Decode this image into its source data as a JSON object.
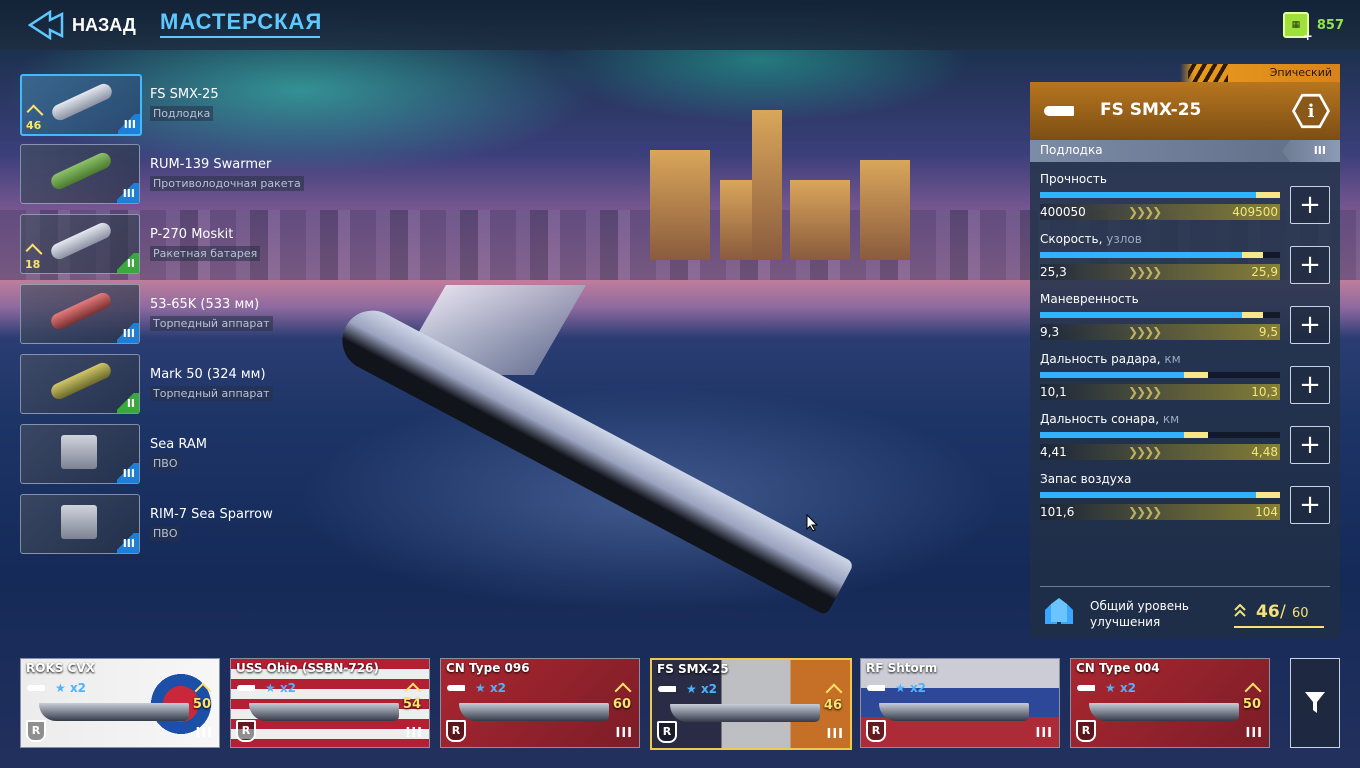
{
  "topbar": {
    "back_label": "НАЗАД",
    "title": "МАСТЕРСКАЯ",
    "title_sub": "",
    "currency": "857",
    "currency_icon": "green-token-icon"
  },
  "modules": [
    {
      "name": "FS SMX-25",
      "type": "Подлодка",
      "level": "46",
      "tier": "III",
      "tier_color": "#1e7fd8",
      "selected": true
    },
    {
      "name": "RUM-139 Swarmer",
      "type": "Противолодочная ракета",
      "level": "",
      "tier": "III",
      "tier_color": "#1e7fd8",
      "selected": false
    },
    {
      "name": "P-270 Moskit",
      "type": "Ракетная батарея",
      "level": "18",
      "tier": "II",
      "tier_color": "#39a83d",
      "selected": false
    },
    {
      "name": "53-65K (533 мм)",
      "type": "Торпедный аппарат",
      "level": "",
      "tier": "III",
      "tier_color": "#1e7fd8",
      "selected": false
    },
    {
      "name": "Mark 50 (324 мм)",
      "type": "Торпедный аппарат",
      "level": "",
      "tier": "II",
      "tier_color": "#39a83d",
      "selected": false
    },
    {
      "name": "Sea RAM",
      "type": "ПВО",
      "level": "",
      "tier": "III",
      "tier_color": "#1e7fd8",
      "selected": false
    },
    {
      "name": "RIM-7 Sea Sparrow",
      "type": "ПВО",
      "level": "",
      "tier": "III",
      "tier_color": "#1e7fd8",
      "selected": false
    }
  ],
  "panel": {
    "rarity": "Эпический",
    "title": "FS SMX-25",
    "class": "Подлодка",
    "tier": "III",
    "stats": [
      {
        "label": "Прочность",
        "unit": "",
        "current": "400050",
        "max": "409500",
        "fill": 0.9,
        "upgrade": 0.1
      },
      {
        "label": "Скорость,",
        "unit": "узлов",
        "current": "25,3",
        "max": "25,9",
        "fill": 0.84,
        "upgrade": 0.09
      },
      {
        "label": "Маневренность",
        "unit": "",
        "current": "9,3",
        "max": "9,5",
        "fill": 0.84,
        "upgrade": 0.09
      },
      {
        "label": "Дальность радара,",
        "unit": "км",
        "current": "10,1",
        "max": "10,3",
        "fill": 0.6,
        "upgrade": 0.1
      },
      {
        "label": "Дальность сонара,",
        "unit": "км",
        "current": "4,41",
        "max": "4,48",
        "fill": 0.6,
        "upgrade": 0.1
      },
      {
        "label": "Запас воздуха",
        "unit": "",
        "current": "101,6",
        "max": "104",
        "fill": 0.9,
        "upgrade": 0.1
      }
    ],
    "upgrade": {
      "label": "Общий уровень улучшения",
      "current": "46",
      "sep": "/",
      "max": "60"
    }
  },
  "fleet": [
    {
      "name": "ROKS CVX",
      "stars": "x2",
      "level": "50",
      "tier": "III",
      "flag": "korea",
      "selected": false
    },
    {
      "name": "USS Ohio (SSBN-726)",
      "stars": "x2",
      "level": "54",
      "tier": "III",
      "flag": "usa",
      "selected": false
    },
    {
      "name": "CN Type 096",
      "stars": "x2",
      "level": "60",
      "tier": "III",
      "flag": "china",
      "selected": false
    },
    {
      "name": "FS SMX-25",
      "stars": "x2",
      "level": "46",
      "tier": "III",
      "flag": "france",
      "selected": true
    },
    {
      "name": "RF Shtorm",
      "stars": "x2",
      "level": "",
      "tier": "III",
      "flag": "russia",
      "selected": false
    },
    {
      "name": "CN Type 004",
      "stars": "x2",
      "level": "50",
      "tier": "III",
      "flag": "china",
      "selected": false
    }
  ],
  "fleet_rank_letter": "R",
  "colors": {
    "accent": "#5fc8ff",
    "epic": "#e89a1e",
    "bar": "#2fb2ff",
    "upgrade": "#f5e78a",
    "currency": "#8ee34e"
  }
}
